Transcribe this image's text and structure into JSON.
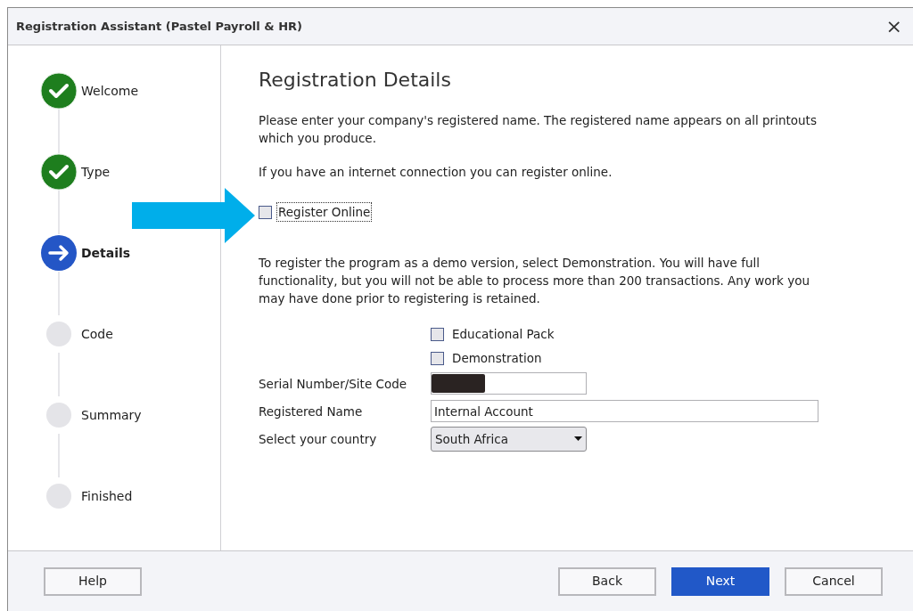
{
  "window": {
    "title": "Registration Assistant (Pastel Payroll & HR)",
    "close": "×"
  },
  "steps": [
    {
      "label": "Welcome",
      "kind": "done"
    },
    {
      "label": "Type",
      "kind": "done"
    },
    {
      "label": "Details",
      "kind": "current"
    },
    {
      "label": "Code",
      "kind": "pending"
    },
    {
      "label": "Summary",
      "kind": "pending"
    },
    {
      "label": "Finished",
      "kind": "pending"
    }
  ],
  "heading": "Registration Details",
  "intro": "Please enter your company's registered name. The registered name appears on all printouts which you produce.",
  "online_note": "If you have an internet connection you can register online.",
  "register_online": {
    "label": "Register Online",
    "checked": false,
    "focused": true
  },
  "demo_note": "To register the program as a demo version, select Demonstration. You will have full functionality, but you will not be able to process more than 200 transactions. Any work you may have done prior to registering is retained.",
  "options": [
    {
      "label": "Educational Pack",
      "checked": false
    },
    {
      "label": "Demonstration",
      "checked": false
    }
  ],
  "fields": [
    {
      "label": "Serial Number/Site Code",
      "kind": "redacted"
    },
    {
      "label": "Registered Name",
      "kind": "text",
      "value": "Internal Account"
    },
    {
      "label": "Select your country",
      "kind": "select",
      "value": "South Africa"
    }
  ],
  "buttons": [
    {
      "label": "Help",
      "primary": false
    },
    {
      "label": "Back",
      "primary": false
    },
    {
      "label": "Next",
      "primary": true
    },
    {
      "label": "Cancel",
      "primary": false
    }
  ]
}
